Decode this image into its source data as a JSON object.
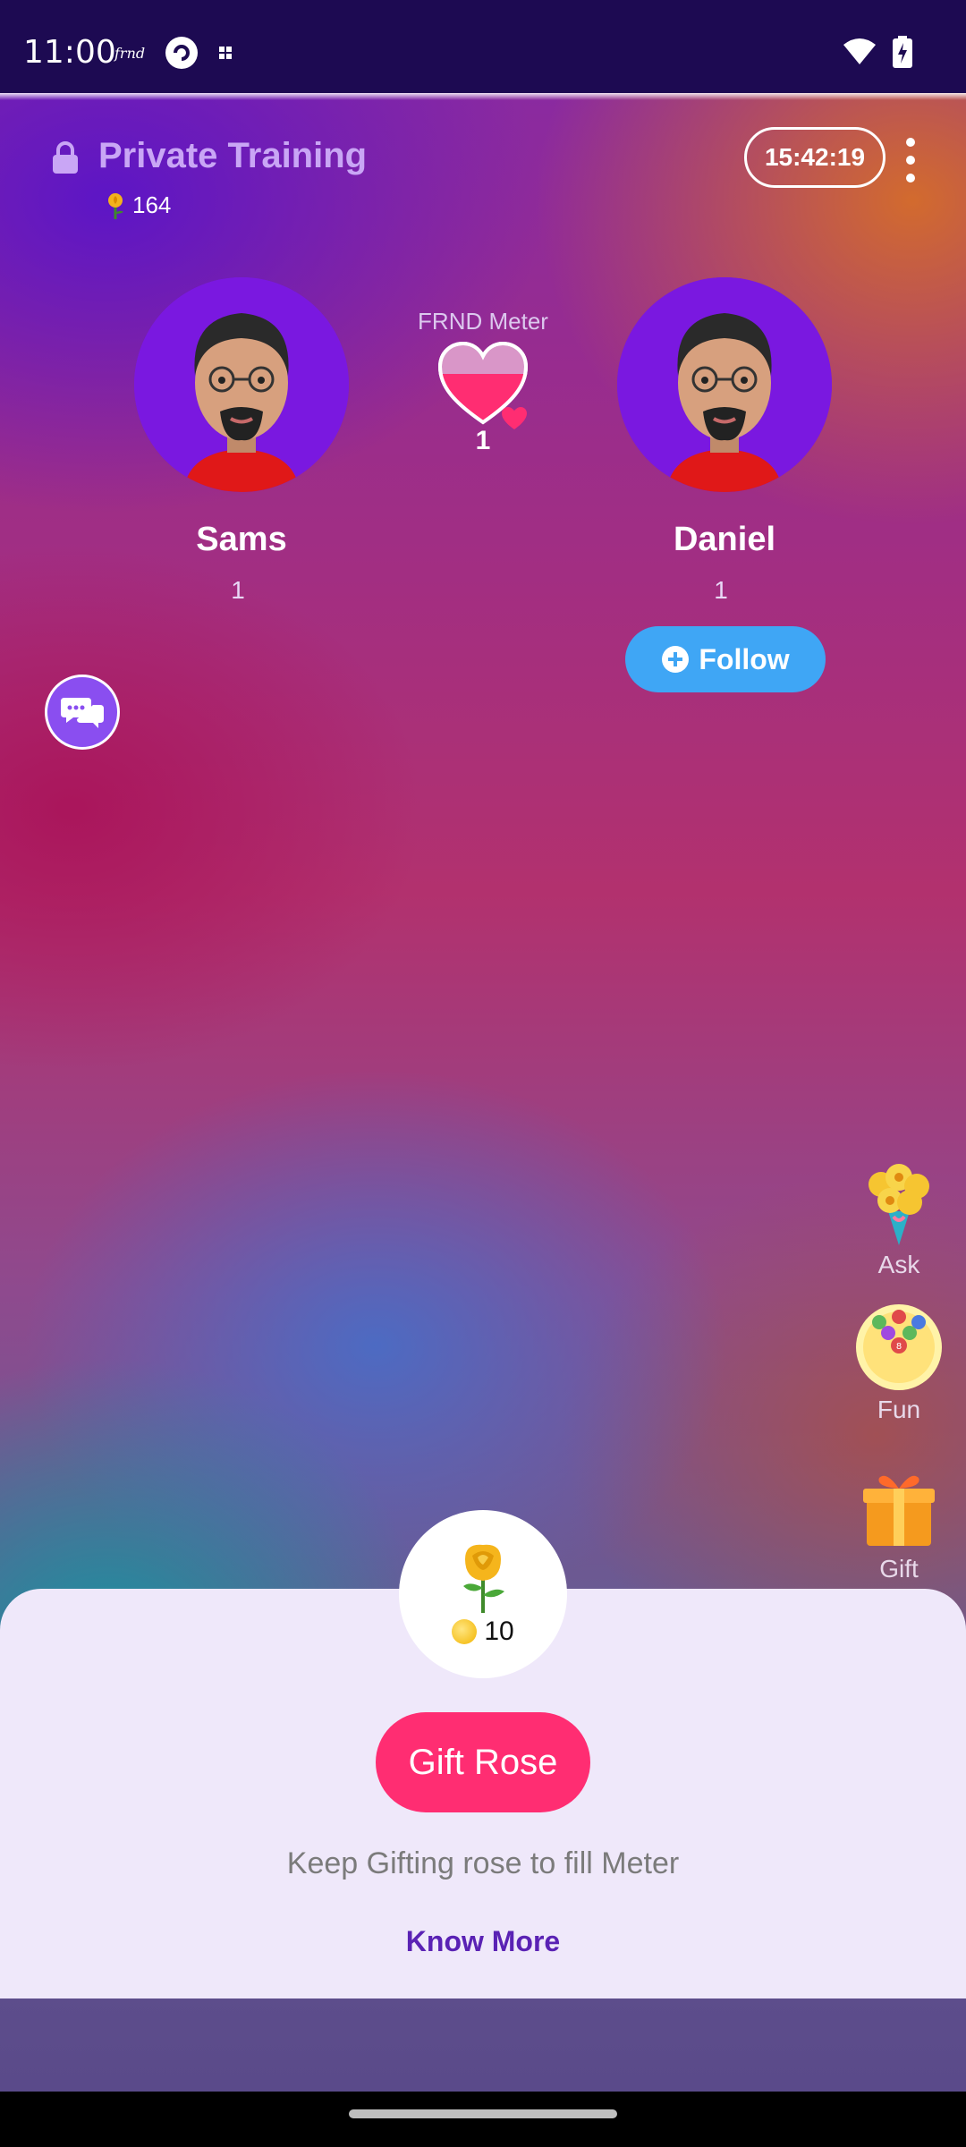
{
  "status_bar": {
    "time": "11:00",
    "app_icons": [
      "frnd-icon",
      "browser-icon",
      "grid-icon"
    ],
    "right_icons": [
      "wifi-icon",
      "battery-charging-icon"
    ]
  },
  "room": {
    "title": "Private Training",
    "rose_count": "164",
    "timer": "15:42:19"
  },
  "meter": {
    "label": "FRND Meter",
    "value": "1",
    "color": "#ff2d72"
  },
  "users": [
    {
      "name": "Sams",
      "count": "1"
    },
    {
      "name": "Daniel",
      "count": "1"
    }
  ],
  "follow_button": {
    "label": "Follow",
    "color": "#3fa6f5"
  },
  "side_actions": [
    {
      "label": "Ask",
      "icon": "flower-bouquet-icon"
    },
    {
      "label": "Fun",
      "icon": "bingo-balls-icon"
    },
    {
      "label": "Gift",
      "icon": "gift-box-icon"
    }
  ],
  "gift_sheet": {
    "item_icon": "rose-icon",
    "price": "10",
    "button_label": "Gift Rose",
    "hint": "Keep Gifting rose to fill Meter",
    "know_more": "Know More",
    "accent": "#ff2d72",
    "link_color": "#5a22b4"
  }
}
